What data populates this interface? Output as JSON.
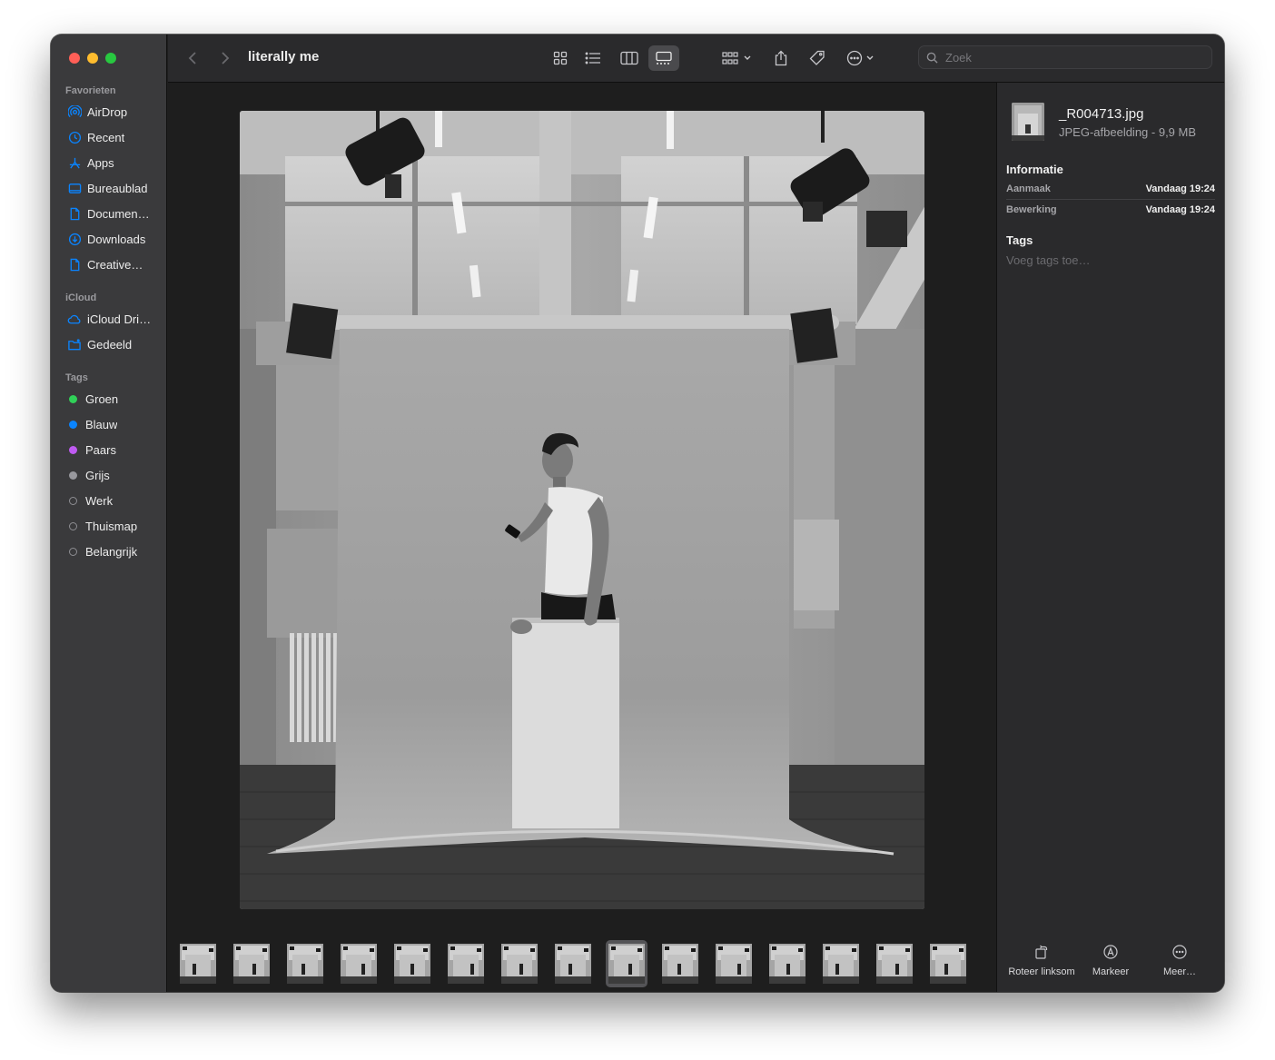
{
  "window": {
    "traffic_colors": [
      "#ff5f57",
      "#febc2e",
      "#28c840"
    ]
  },
  "sidebar": {
    "favorites_label": "Favorieten",
    "favorites": [
      {
        "label": "AirDrop",
        "icon": "airdrop-icon"
      },
      {
        "label": "Recent",
        "icon": "clock-icon"
      },
      {
        "label": "Apps",
        "icon": "apps-icon"
      },
      {
        "label": "Bureaublad",
        "icon": "desktop-icon"
      },
      {
        "label": "Documen…",
        "icon": "document-icon"
      },
      {
        "label": "Downloads",
        "icon": "download-icon"
      },
      {
        "label": "Creative…",
        "icon": "document-icon"
      }
    ],
    "icloud_label": "iCloud",
    "icloud": [
      {
        "label": "iCloud Dri…",
        "icon": "cloud-icon"
      },
      {
        "label": "Gedeeld",
        "icon": "shared-folder-icon"
      }
    ],
    "tags_label": "Tags",
    "tags": [
      {
        "label": "Groen",
        "color": "#30d158",
        "hollow": false
      },
      {
        "label": "Blauw",
        "color": "#0a84ff",
        "hollow": false
      },
      {
        "label": "Paars",
        "color": "#bf5af2",
        "hollow": false
      },
      {
        "label": "Grijs",
        "color": "#98989d",
        "hollow": false
      },
      {
        "label": "Werk",
        "color": "",
        "hollow": true
      },
      {
        "label": "Thuismap",
        "color": "",
        "hollow": true
      },
      {
        "label": "Belangrijk",
        "color": "",
        "hollow": true
      }
    ],
    "accent": "#0a84ff"
  },
  "toolbar": {
    "title": "literally me",
    "search_placeholder": "Zoek",
    "view_buttons": [
      "icon-view-icon",
      "list-view-icon",
      "column-view-icon",
      "gallery-view-icon"
    ],
    "active_view": "gallery-view-icon"
  },
  "filmstrip": {
    "count": 15,
    "selected_index": 8
  },
  "inspector": {
    "file_name": "_R004713.jpg",
    "file_kind": "JPEG-afbeelding - 9,9 MB",
    "info_heading": "Informatie",
    "rows": [
      {
        "key": "Aanmaak",
        "value": "Vandaag 19:24"
      },
      {
        "key": "Bewerking",
        "value": "Vandaag 19:24"
      }
    ],
    "tags_heading": "Tags",
    "tags_placeholder": "Voeg tags toe…",
    "actions": [
      {
        "label": "Roteer linksom",
        "icon": "rotate-left-icon"
      },
      {
        "label": "Markeer",
        "icon": "markup-icon"
      },
      {
        "label": "Meer…",
        "icon": "more-icon"
      }
    ]
  }
}
